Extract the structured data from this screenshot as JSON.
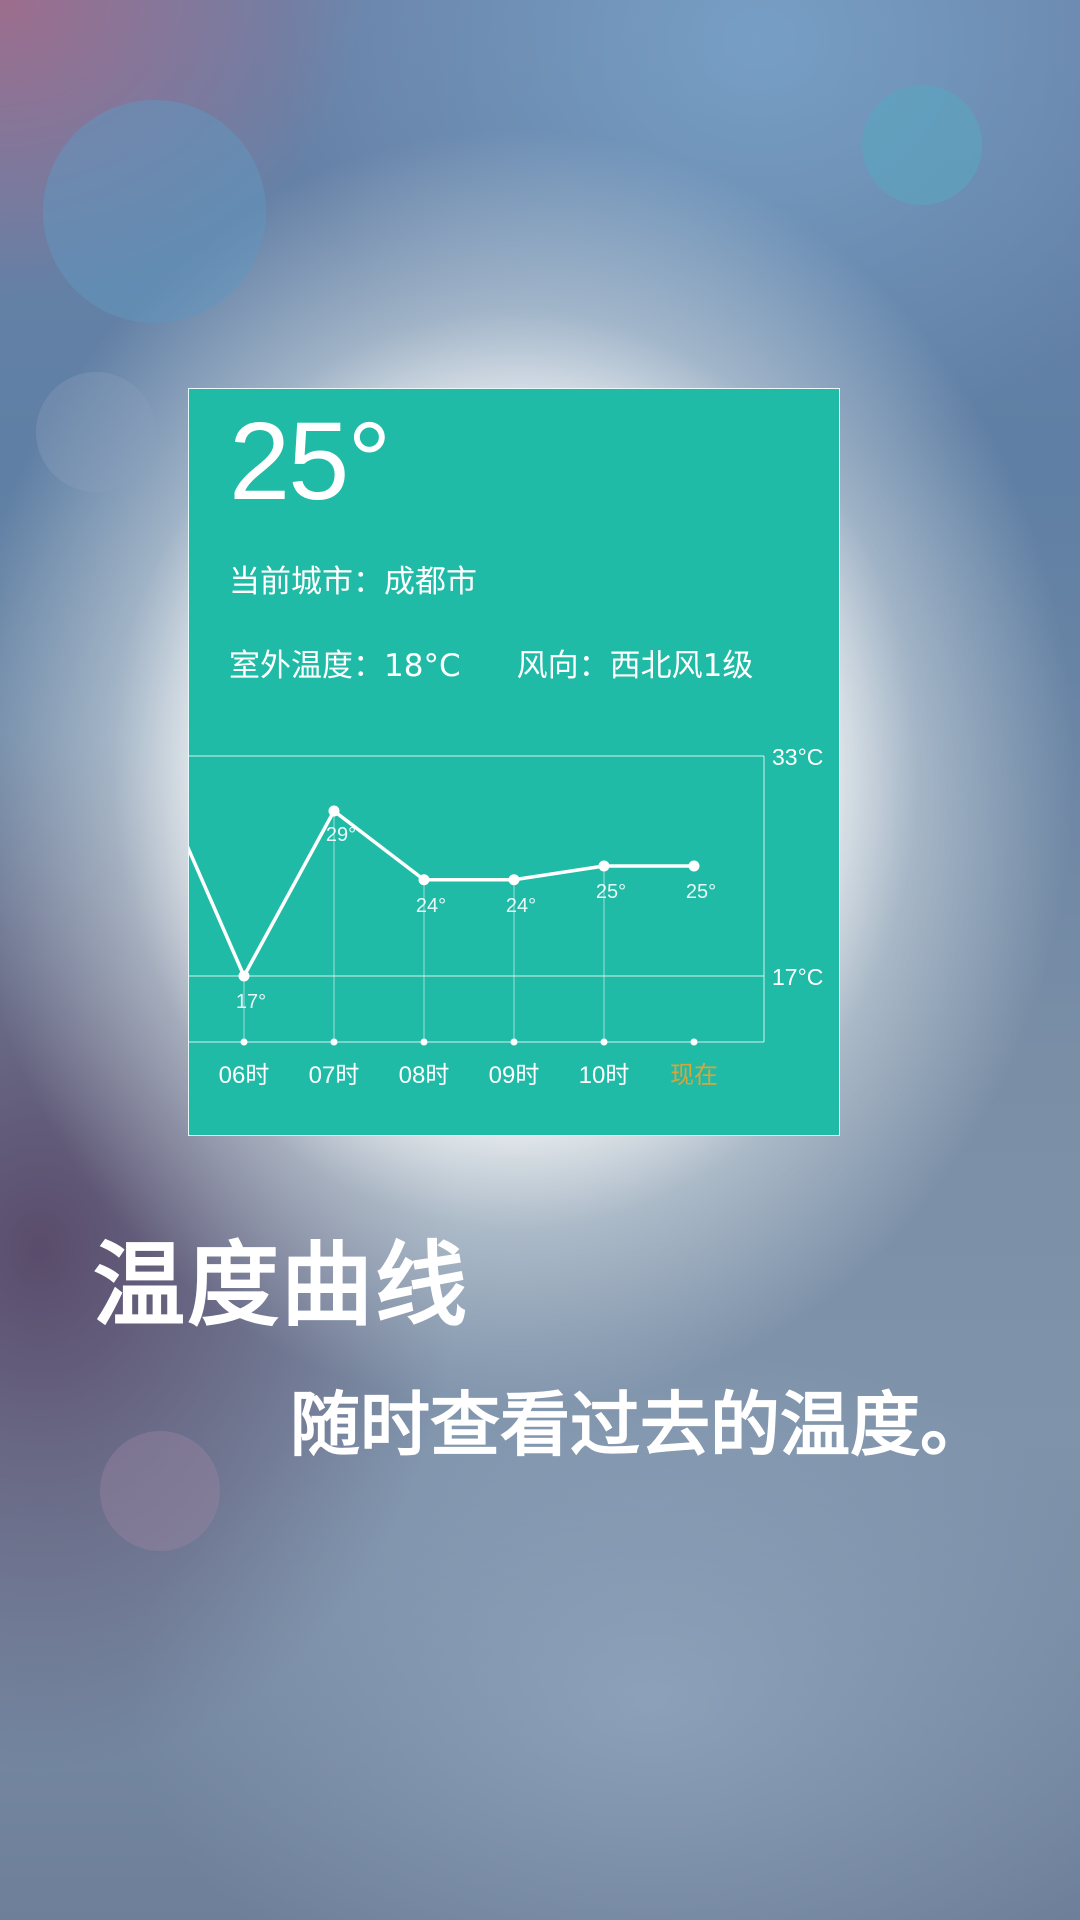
{
  "widget": {
    "current_temp": "25°",
    "city_label": "当前城市：",
    "city_value": "成都市",
    "outdoor_label": "室外温度：",
    "outdoor_value": "18°C",
    "wind_label": "风向：",
    "wind_value": "西北风1级",
    "accent_color": "#1fbba6"
  },
  "chart_data": {
    "type": "line",
    "ylim_labels": [
      "33°C",
      "17°C"
    ],
    "ylim": [
      17,
      33
    ],
    "categories": [
      "06时",
      "07时",
      "08时",
      "09时",
      "10时",
      "现在"
    ],
    "series": [
      {
        "values": [
          17,
          29,
          24,
          24,
          25,
          25
        ]
      }
    ],
    "point_labels": [
      "17°",
      "29°",
      "24°",
      "24°",
      "25°",
      "25°"
    ],
    "highlight_category": "现在",
    "highlight_color": "#d9a43a"
  },
  "promo": {
    "title": "温度曲线",
    "subtitle": "随时查看过去的温度。"
  }
}
